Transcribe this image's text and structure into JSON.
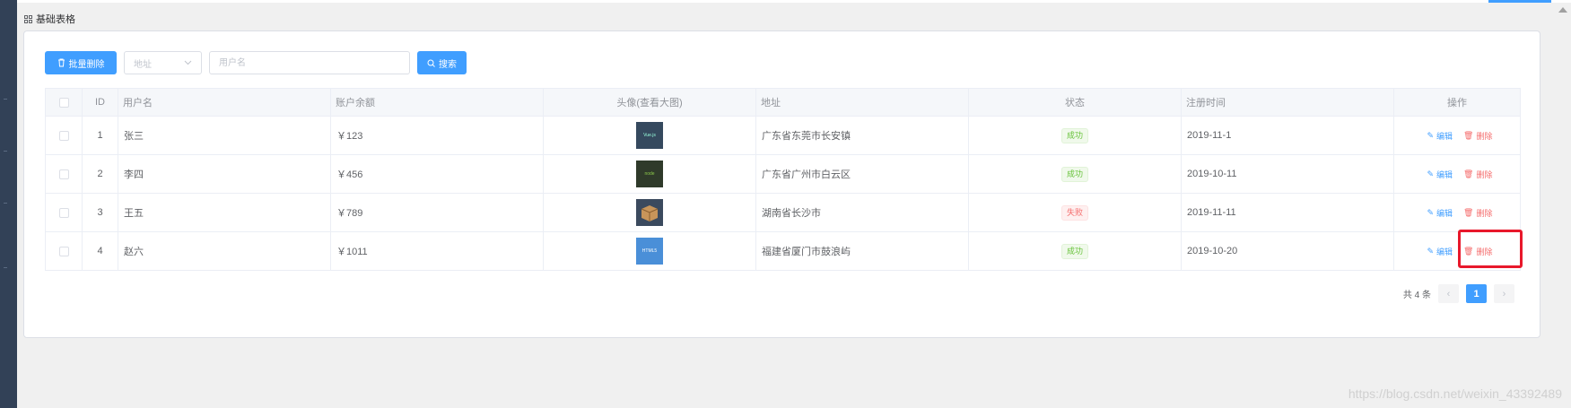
{
  "breadcrumb": {
    "label": "基础表格"
  },
  "toolbar": {
    "batch_delete_label": "批量删除",
    "address_select": "地址",
    "username_placeholder": "用户名",
    "search_label": "搜索"
  },
  "table": {
    "headers": {
      "id": "ID",
      "username": "用户名",
      "balance": "账户余额",
      "avatar": "头像(查看大图)",
      "address": "地址",
      "status": "状态",
      "reg_time": "注册时间",
      "actions": "操作"
    },
    "rows": [
      {
        "id": "1",
        "name": "张三",
        "balance": "￥123",
        "avatar_icon": "vue-logo-icon",
        "avatar_text": "Vue.js",
        "address": "广东省东莞市长安镇",
        "status": "成功",
        "status_type": "success",
        "reg_time": "2019-11-1",
        "edit": "编辑",
        "delete": "删除"
      },
      {
        "id": "2",
        "name": "李四",
        "balance": "￥456",
        "avatar_icon": "node-logo-icon",
        "avatar_text": "node",
        "address": "广东省广州市白云区",
        "status": "成功",
        "status_type": "success",
        "reg_time": "2019-10-11",
        "edit": "编辑",
        "delete": "删除"
      },
      {
        "id": "3",
        "name": "王五",
        "balance": "￥789",
        "avatar_icon": "box-logo-icon",
        "avatar_text": "",
        "address": "湖南省长沙市",
        "status": "失败",
        "status_type": "danger",
        "reg_time": "2019-11-11",
        "edit": "编辑",
        "delete": "删除"
      },
      {
        "id": "4",
        "name": "赵六",
        "balance": "￥1011",
        "avatar_icon": "html5-logo-icon",
        "avatar_text": "HTML5",
        "address": "福建省厦门市鼓浪屿",
        "status": "成功",
        "status_type": "success",
        "reg_time": "2019-10-20",
        "edit": "编辑",
        "delete": "删除"
      }
    ]
  },
  "pagination": {
    "total_text": "共 4 条",
    "current_page": "1",
    "prev": "‹",
    "next": "›"
  },
  "watermark": "https://blog.csdn.net/weixin_43392489",
  "colors": {
    "primary": "#409eff",
    "danger": "#f56c6c",
    "success": "#67c23a",
    "highlight": "#e8182b"
  }
}
